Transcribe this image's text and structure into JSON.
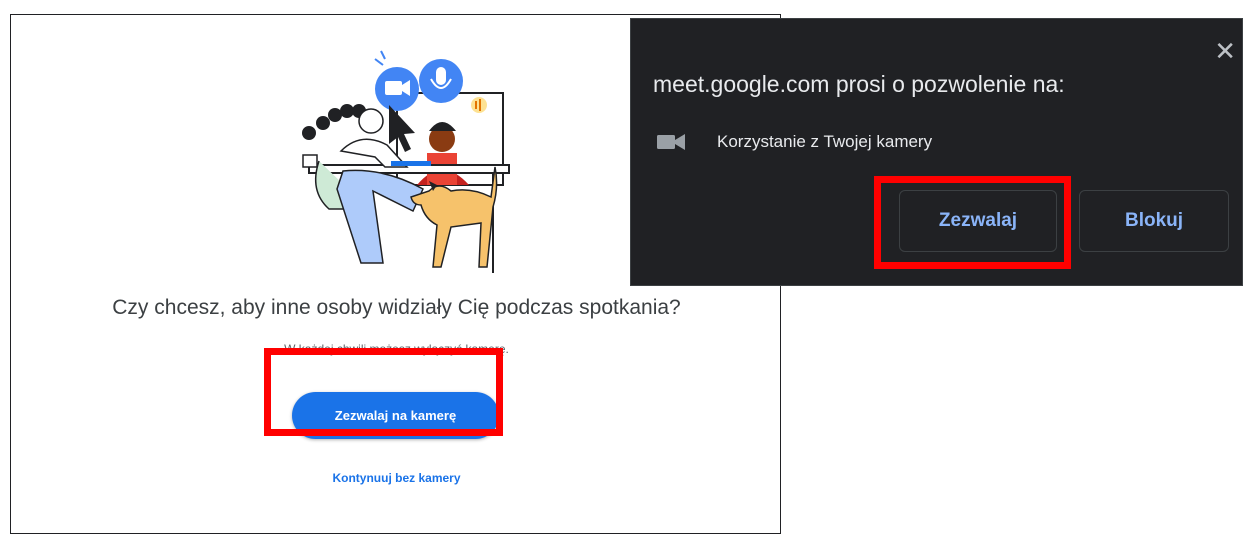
{
  "meet": {
    "headline": "Czy chcesz, aby inne osoby widziały Cię podczas spotkania?",
    "subtext": "W każdej chwili możesz wyłączyć kamerę.",
    "allow_camera_label": "Zezwalaj na kamerę",
    "continue_label": "Kontynuuj bez kamery"
  },
  "permission_popup": {
    "title": "meet.google.com prosi o pozwolenie na:",
    "item_label": "Korzystanie z Twojej kamery",
    "item_icon": "video-camera-icon",
    "close_glyph": "✕",
    "allow_label": "Zezwalaj",
    "block_label": "Blokuj"
  },
  "colors": {
    "meet_blue": "#1a73e8",
    "popup_bg": "#202124",
    "popup_button_text": "#8ab4f8",
    "highlight": "#ff0000"
  }
}
